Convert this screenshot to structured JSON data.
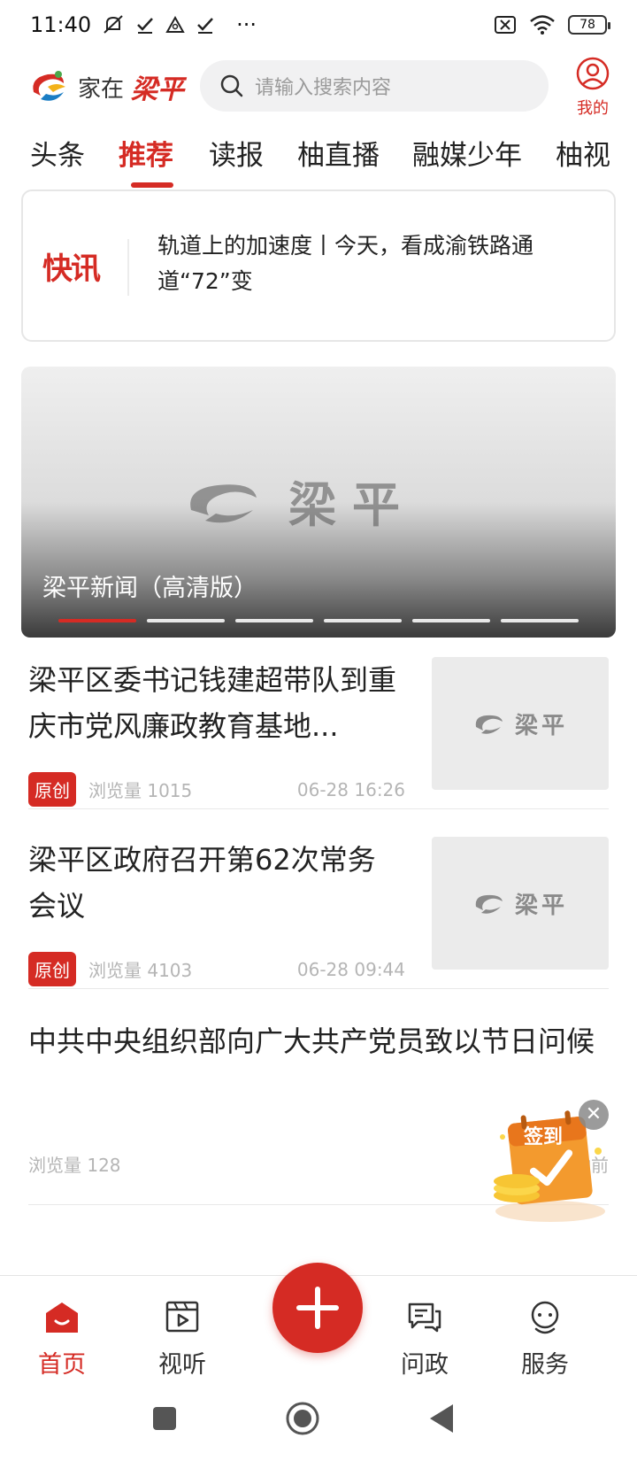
{
  "status_bar": {
    "time": "11:40",
    "dots": "···",
    "battery": "78"
  },
  "header": {
    "logo_prefix": "家在",
    "logo_brush": "梁平",
    "search_placeholder": "请输入搜索内容",
    "me_label": "我的"
  },
  "tabs": [
    {
      "label": "头条"
    },
    {
      "label": "推荐",
      "active": true
    },
    {
      "label": "读报"
    },
    {
      "label": "柚直播"
    },
    {
      "label": "融媒少年"
    },
    {
      "label": "柚视"
    }
  ],
  "flash": {
    "logo": "快讯",
    "text": "轨道上的加速度丨今天，看成渝铁路通道“72”变"
  },
  "carousel": {
    "watermark": "梁平",
    "caption": "梁平新闻（高清版）",
    "slide_count": 6,
    "active_index": 0
  },
  "news": [
    {
      "title": "梁平区委书记钱建超带队到重庆市党风廉政教育基地...",
      "badge": "原创",
      "views": "浏览量 1015",
      "time": "06-28 16:26",
      "thumb_text": "梁平"
    },
    {
      "title": "梁平区政府召开第62次常务会议",
      "badge": "原创",
      "views": "浏览量 4103",
      "time": "06-28 09:44",
      "thumb_text": "梁平"
    },
    {
      "title": "中共中央组织部向广大共产党员致以节日问候",
      "badge": "",
      "views": "浏览量 128",
      "time": "40分钟前"
    }
  ],
  "checkin": {
    "label": "签到"
  },
  "bottom_nav": [
    {
      "label": "首页",
      "icon": "home-icon",
      "active": true
    },
    {
      "label": "视听",
      "icon": "video-icon"
    },
    {
      "label": "问政",
      "icon": "chat-icon"
    },
    {
      "label": "服务",
      "icon": "service-icon"
    }
  ],
  "colors": {
    "accent": "#d52b24",
    "muted": "#b5b5b5"
  }
}
